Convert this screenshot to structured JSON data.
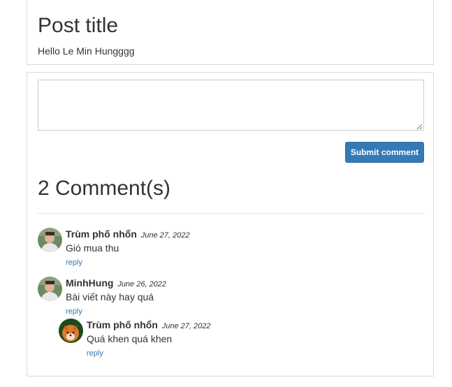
{
  "post": {
    "title": "Post title",
    "body": "Hello Le Min Hungggg"
  },
  "comment_form": {
    "textarea_value": "",
    "submit_label": "Submit comment",
    "button_color": "#337ab7"
  },
  "comments_section": {
    "heading": "2 Comment(s)",
    "link_color": "#337ab7",
    "comments": [
      {
        "author": "Trùm phố nhổn",
        "date": "June 27, 2022",
        "text": "Gió mua thu",
        "reply_label": "reply",
        "avatar_icon": "user-photo-avatar"
      },
      {
        "author": "MinhHung",
        "date": "June 26, 2022",
        "text": "Bài viết này hay quá",
        "reply_label": "reply",
        "avatar_icon": "user-photo-avatar",
        "replies": [
          {
            "author": "Trùm phố nhổn",
            "date": "June 27, 2022",
            "text": "Quá khen quá khen",
            "reply_label": "reply",
            "avatar_icon": "dog-photo-avatar"
          }
        ]
      }
    ]
  }
}
